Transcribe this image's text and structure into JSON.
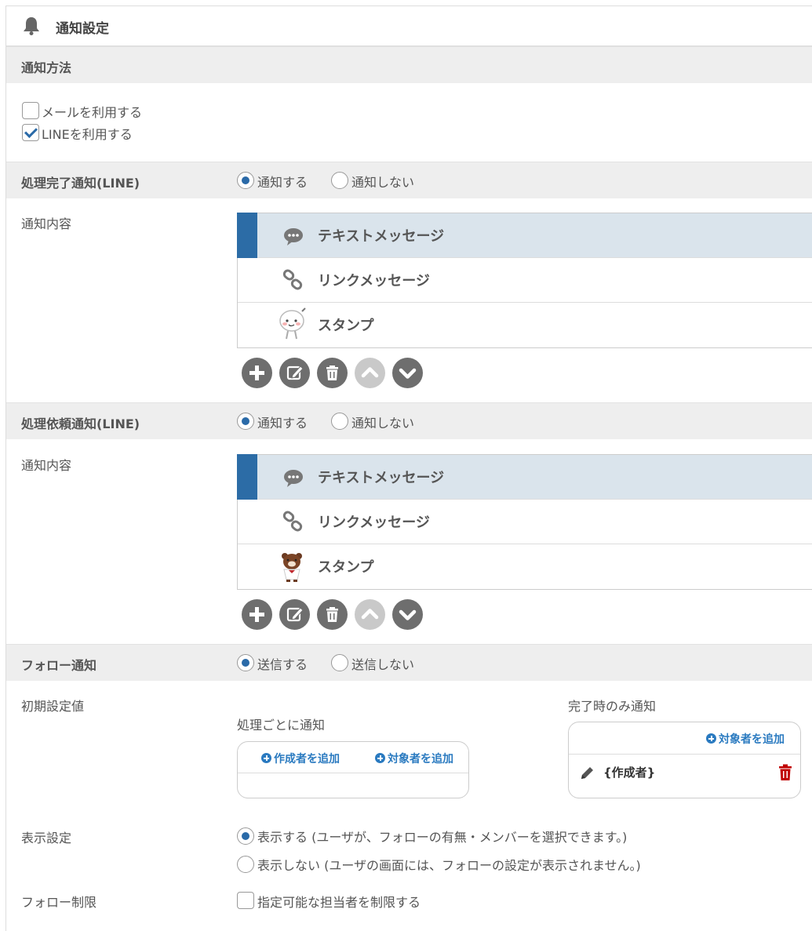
{
  "header": {
    "title": "通知設定",
    "icon": "bell-icon"
  },
  "method": {
    "section_label": "通知方法",
    "options": [
      {
        "label": "メールを利用する",
        "checked": false
      },
      {
        "label": "LINEを利用する",
        "checked": true
      }
    ]
  },
  "completion": {
    "section_label": "処理完了通知(LINE)",
    "radio_on": "通知する",
    "radio_off": "通知しない",
    "content_label": "通知内容",
    "items": [
      {
        "label": "テキストメッセージ",
        "icon": "speech-bubble-icon"
      },
      {
        "label": "リンクメッセージ",
        "icon": "link-icon"
      },
      {
        "label": "スタンプ",
        "icon": "sticker-icon"
      }
    ]
  },
  "request": {
    "section_label": "処理依頼通知(LINE)",
    "radio_on": "通知する",
    "radio_off": "通知しない",
    "content_label": "通知内容",
    "items": [
      {
        "label": "テキストメッセージ",
        "icon": "speech-bubble-icon"
      },
      {
        "label": "リンクメッセージ",
        "icon": "link-icon"
      },
      {
        "label": "スタンプ",
        "icon": "bear-sticker-icon"
      }
    ]
  },
  "follow": {
    "section_label": "フォロー通知",
    "radio_on": "送信する",
    "radio_off": "送信しない",
    "initial_label": "初期設定値",
    "per_process_label": "処理ごとに通知",
    "add_creator": "作成者を追加",
    "add_target": "対象者を追加",
    "completion_only_label": "完了時のみ通知",
    "completion_entry": "{作成者}",
    "display_label": "表示設定",
    "display_show": "表示する (ユーザが、フォローの有無・メンバーを選択できます。)",
    "display_hide": "表示しない (ユーザの画面には、フォローの設定が表示されません。)",
    "limit_label": "フォロー制限",
    "limit_option": "指定可能な担当者を制限する"
  },
  "colors": {
    "accent": "#2c6ca6",
    "link": "#2a7ac0",
    "delete": "#c00000",
    "section_bg": "#eeeeee"
  }
}
